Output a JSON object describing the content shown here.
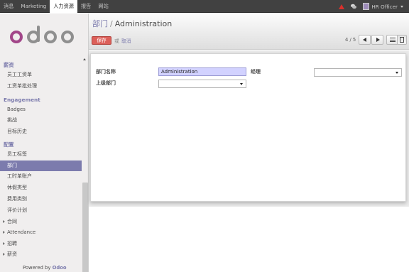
{
  "topbar": {
    "menu": [
      "消息",
      "Marketing",
      "人力资源",
      "报告",
      "网站"
    ],
    "active_index": 2,
    "user_name": "HR Officer",
    "alert_color": "#d9302c"
  },
  "sidebar": {
    "logo_text": "odoo",
    "sections": [
      {
        "title": "薪资",
        "items": [
          "员工工资单",
          "工资单批处理"
        ]
      },
      {
        "title": "Engagement",
        "items": [
          "Badges",
          "挑战",
          "目标历史"
        ]
      },
      {
        "title": "配置",
        "items": [
          "员工标签",
          "部门",
          "工时单账户",
          "休假类型",
          "费用类别",
          "评价计划"
        ]
      }
    ],
    "collapsed_items": [
      "合同",
      "Attendance",
      "招聘",
      "薪资"
    ],
    "active_item": "部门",
    "powered_by": "Powered by",
    "powered_brand": "Odoo",
    "accent_color": "#7c7bad"
  },
  "header": {
    "breadcrumb_parent": "部门",
    "breadcrumb_separator": "/",
    "breadcrumb_current": "Administration",
    "save_label": "保存",
    "or_label": "或",
    "discard_label": "取消",
    "pager": "4 / 5"
  },
  "form": {
    "name_label": "部门名称",
    "name_value": "Administration",
    "parent_label": "上级部门",
    "parent_value": "",
    "manager_label": "经理",
    "manager_value": ""
  }
}
